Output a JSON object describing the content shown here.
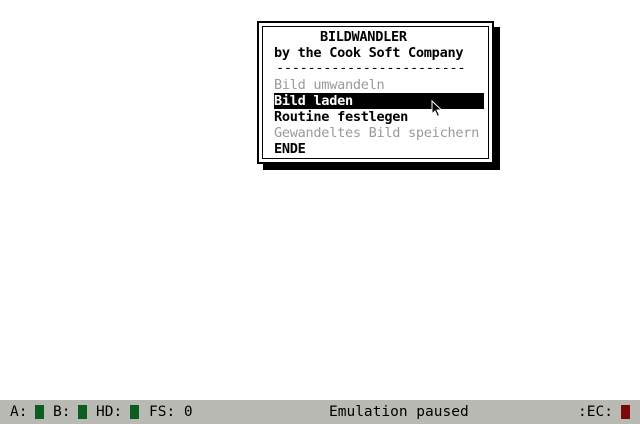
{
  "dialog": {
    "title": "BILDWANDLER",
    "subtitle": "by the Cook Soft Company",
    "separator": "------------------------",
    "menu": [
      {
        "label": "Bild umwandeln",
        "enabled": false,
        "selected": false
      },
      {
        "label": "Bild laden",
        "enabled": true,
        "selected": true
      },
      {
        "label": "Routine festlegen",
        "enabled": true,
        "selected": false
      },
      {
        "label": "Gewandeltes Bild speichern",
        "enabled": false,
        "selected": false
      },
      {
        "label": "ENDE",
        "enabled": true,
        "selected": false
      }
    ]
  },
  "statusbar": {
    "drive_a": "A:",
    "drive_b": "B:",
    "drive_hd": "HD:",
    "fs": "FS: 0",
    "status": "Emulation paused",
    "ec": ":EC:",
    "led_color": "#0d5e1e",
    "ec_led_color": "#7a0a0a"
  },
  "colors": {
    "background": "#ffffff",
    "statusbar_bg": "#b9bab4",
    "disabled_text": "#9a9a9a"
  }
}
